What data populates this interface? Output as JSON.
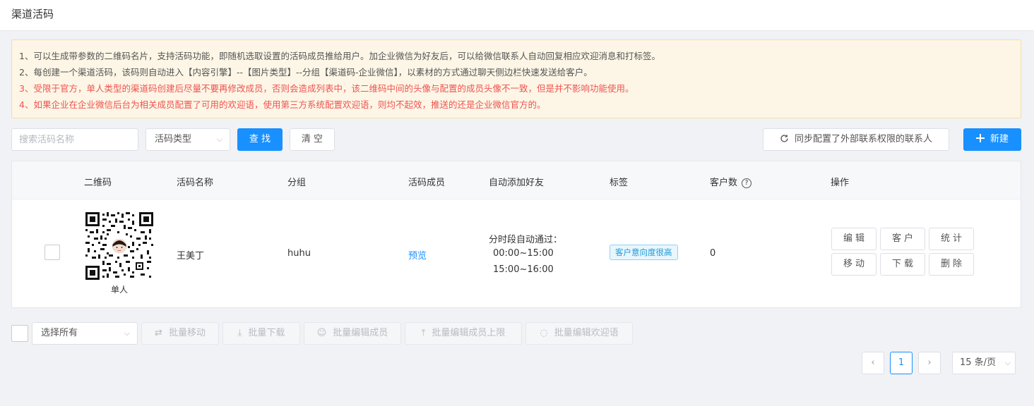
{
  "header": {
    "title": "渠道活码"
  },
  "notice": {
    "lines": [
      "1、可以生成带参数的二维码名片，支持活码功能，即随机选取设置的活码成员推给用户。加企业微信为好友后，可以给微信联系人自动回复相应欢迎消息和打标签。",
      "2、每创建一个渠道活码，该码则自动进入【内容引擎】--【图片类型】--分组【渠道码-企业微信】，以素材的方式通过聊天侧边栏快速发送给客户。",
      "3、受限于官方，单人类型的渠道码创建后尽量不要再修改成员，否则会造成列表中，该二维码中间的头像与配置的成员头像不一致，但是并不影响功能使用。",
      "4、如果企业在企业微信后台为相关成员配置了可用的欢迎语，使用第三方系统配置欢迎语，则均不起效，推送的还是企业微信官方的。"
    ]
  },
  "toolbar": {
    "search_placeholder": "搜索活码名称",
    "type_select": "活码类型",
    "search_label": "查 找",
    "clear_label": "清 空",
    "sync_label": "同步配置了外部联系权限的联系人",
    "new_label": "新建"
  },
  "table": {
    "columns": [
      "二维码",
      "活码名称",
      "分组",
      "活码成员",
      "自动添加好友",
      "标签",
      "客户数",
      "操作"
    ],
    "rows": [
      {
        "qr_caption": "单人",
        "name": "王美丁",
        "group": "huhu",
        "members": "预览",
        "auto_add": [
          "分时段自动通过：",
          "00:00~15:00",
          "15:00~16:00"
        ],
        "tag": "客户意向度很高",
        "customers": "0",
        "actions": [
          "编辑",
          "客户",
          "统计",
          "移动",
          "下载",
          "删除"
        ]
      }
    ]
  },
  "batch": {
    "select_all": "选择所有",
    "buttons": [
      "批量移动",
      "批量下载",
      "批量编辑成员",
      "批量编辑成员上限",
      "批量编辑欢迎语"
    ]
  },
  "pagination": {
    "current_page": "1",
    "page_size": "15 条/页"
  },
  "colors": {
    "primary": "#1890ff",
    "warning": "#ef5350",
    "notice_bg": "#fdf6e6"
  }
}
